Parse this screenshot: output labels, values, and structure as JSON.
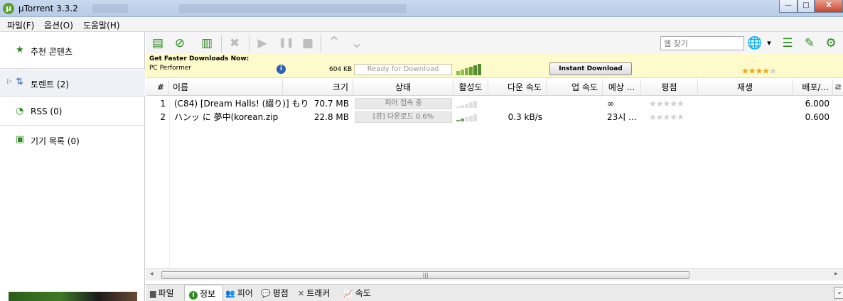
{
  "window": {
    "title": "µTorrent 3.3.2",
    "app_icon": "µ",
    "minimize": "—",
    "maximize": "□",
    "close": "X"
  },
  "menu": [
    "파일(F)",
    "옵션(O)",
    "도움말(H)"
  ],
  "sidebar": {
    "items": [
      {
        "label": "추천 콘텐츠",
        "icon": "star-icon",
        "glyph": "★"
      },
      {
        "label": "토렌트 (2)",
        "icon": "torrents-icon",
        "glyph": "⇅",
        "arrow": "▷"
      },
      {
        "label": "RSS (0)",
        "icon": "rss-icon",
        "glyph": "◔"
      },
      {
        "label": "기기 목록 (0)",
        "icon": "device-icon",
        "glyph": "▣"
      }
    ]
  },
  "toolbar": {
    "buttons": [
      {
        "name": "add-torrent-icon",
        "glyph": "▤",
        "enabled": true
      },
      {
        "name": "add-url-icon",
        "glyph": "⊘",
        "enabled": true
      },
      {
        "name": "create-torrent-icon",
        "glyph": "▥",
        "enabled": true
      },
      {
        "name": "remove-icon",
        "glyph": "✖",
        "enabled": false
      },
      {
        "name": "start-icon",
        "glyph": "▶",
        "enabled": false
      },
      {
        "name": "pause-icon",
        "glyph": "❚❚",
        "enabled": false
      },
      {
        "name": "stop-icon",
        "glyph": "■",
        "enabled": false
      },
      {
        "name": "move-up-icon",
        "glyph": "⌃",
        "enabled": false
      },
      {
        "name": "move-down-icon",
        "glyph": "⌄",
        "enabled": false
      }
    ],
    "search_placeholder": "웹 찾기",
    "right_icons": [
      {
        "name": "web-search-globe-icon",
        "glyph": "🌐"
      },
      {
        "name": "dropdown-arrow-icon",
        "glyph": "▾"
      },
      {
        "name": "list-view-icon",
        "glyph": "☰"
      },
      {
        "name": "remote-icon",
        "glyph": "✎"
      },
      {
        "name": "settings-gear-icon",
        "glyph": "⚙"
      }
    ]
  },
  "ad": {
    "title": "Get Faster Downloads Now:",
    "subtitle": "PC Performer",
    "info_glyph": "i",
    "size": "604 KB",
    "status": "Ready for Download",
    "button": "Instant Download",
    "stars_full": "★★★★",
    "stars_empty": "★"
  },
  "table": {
    "columns": [
      "#",
      "이름",
      "크기",
      "상태",
      "활성도",
      "다운 속도",
      "업 속도",
      "예상 ...",
      "평점",
      "재생",
      "배포/...",
      "ㄹ"
    ],
    "rows": [
      {
        "num": "1",
        "name": "(C84) [Dream Halls! (綴り)] もり...",
        "size": "70.7 MB",
        "status": "피어 접속 중",
        "down": "",
        "up": "",
        "eta": "∞",
        "rating": "★★★★★",
        "play": "",
        "ratio": "6.000",
        "activity_level": 0
      },
      {
        "num": "2",
        "name": "ハンッ に 夢中(korean.zip",
        "size": "22.8 MB",
        "status": "[강] 다운로드 0.6%",
        "down": "0.3 kB/s",
        "up": "",
        "eta": "23시 ...",
        "rating": "★★★★★",
        "play": "",
        "ratio": "0.600",
        "activity_level": 2
      }
    ]
  },
  "scrollbar": {
    "left": "◂",
    "right": "▸",
    "grip": "|||"
  },
  "tabs": [
    {
      "label": "파일",
      "icon": "folder-icon",
      "glyph": "▆",
      "active": false
    },
    {
      "label": "정보",
      "icon": "info-icon",
      "glyph": "i",
      "active": true
    },
    {
      "label": "피어",
      "icon": "peers-icon",
      "glyph": "👥",
      "active": false
    },
    {
      "label": "평점",
      "icon": "ratings-icon",
      "glyph": "💬",
      "active": false
    },
    {
      "label": "트래커",
      "icon": "tracker-icon",
      "glyph": "✕",
      "active": false
    },
    {
      "label": "속도",
      "icon": "speed-icon",
      "glyph": "📈",
      "active": false
    }
  ],
  "expand_glyph": "⌄"
}
